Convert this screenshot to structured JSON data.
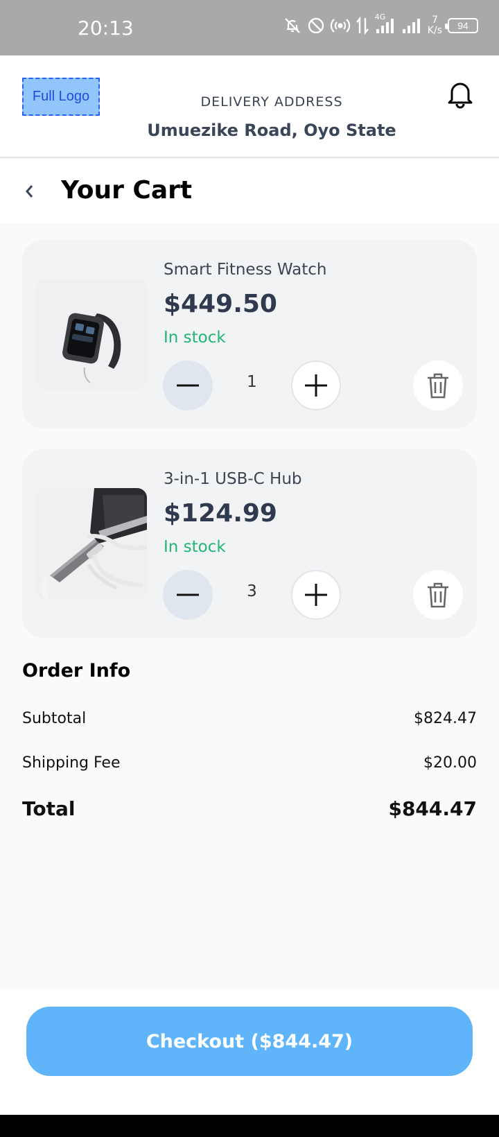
{
  "status_bar": {
    "time": "20:13",
    "network": "4G",
    "speed_value": "7",
    "speed_unit": "K/s",
    "battery": "94"
  },
  "header": {
    "logo_text": "Full Logo",
    "delivery_label": "DELIVERY ADDRESS",
    "delivery_address": "Umuezike Road, Oyo State"
  },
  "page": {
    "title": "Your Cart"
  },
  "cart": {
    "items": [
      {
        "name": "Smart Fitness Watch",
        "price": "$449.50",
        "stock": "In stock",
        "quantity": "1"
      },
      {
        "name": "3-in-1 USB-C Hub",
        "price": "$124.99",
        "stock": "In stock",
        "quantity": "3"
      }
    ]
  },
  "order_info": {
    "title": "Order Info",
    "subtotal_label": "Subtotal",
    "subtotal_value": "$824.47",
    "shipping_label": "Shipping Fee",
    "shipping_value": "$20.00",
    "total_label": "Total",
    "total_value": "$844.47"
  },
  "checkout": {
    "label": "Checkout ($844.47)"
  },
  "colors": {
    "accent": "#60b4fa",
    "in_stock": "#22b573",
    "price": "#2f3a4e",
    "card_bg": "#f2f3f5"
  }
}
